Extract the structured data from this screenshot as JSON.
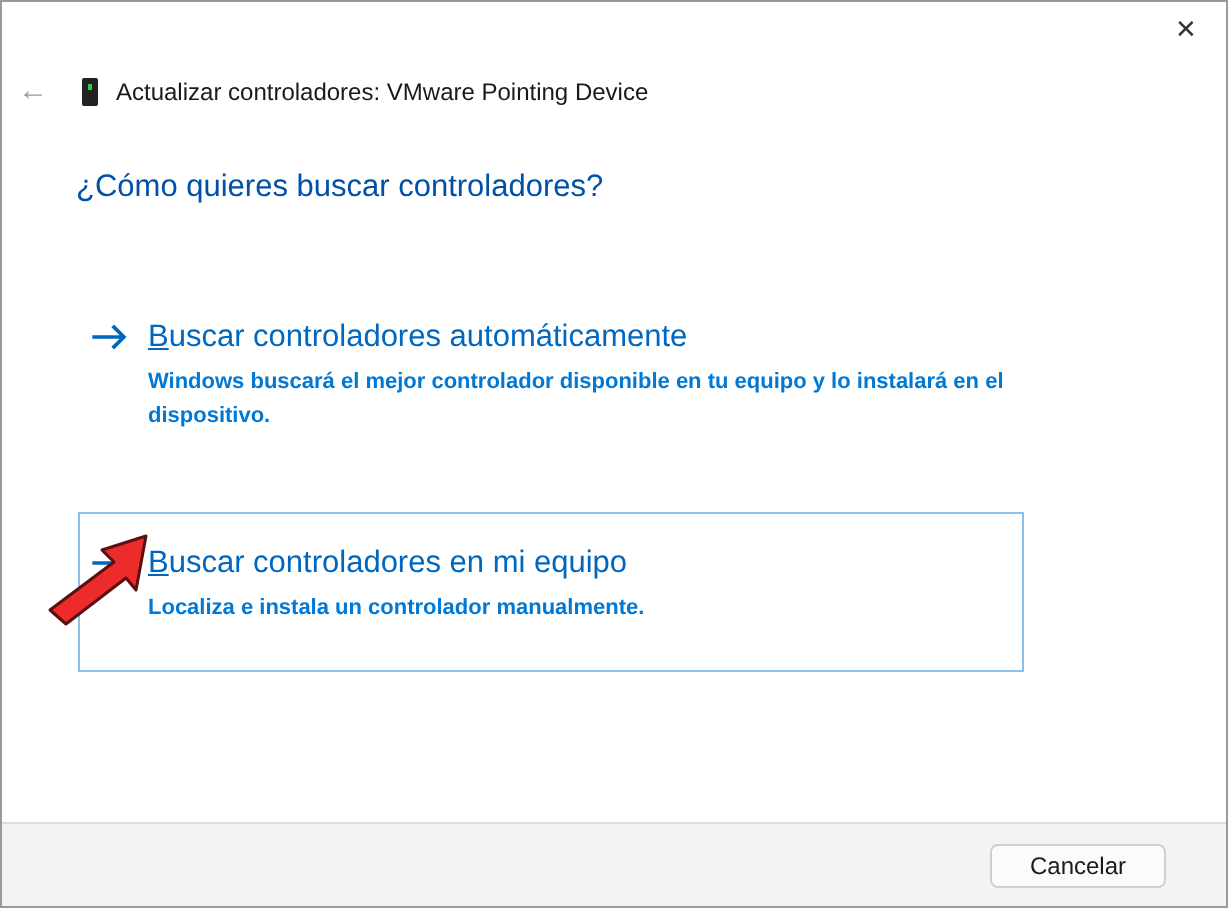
{
  "window": {
    "close": "✕"
  },
  "header": {
    "back": "←",
    "title": "Actualizar controladores: VMware Pointing Device"
  },
  "question": "¿Cómo quieres buscar controladores?",
  "options": [
    {
      "title": "Buscar controladores automáticamente",
      "description": "Windows buscará el mejor controlador disponible en tu equipo y lo instalará en el dispositivo.",
      "selected": false
    },
    {
      "title": "Buscar controladores en mi equipo",
      "description": "Localiza e instala un controlador manualmente.",
      "selected": true
    }
  ],
  "buttons": [
    "Cancelar"
  ]
}
